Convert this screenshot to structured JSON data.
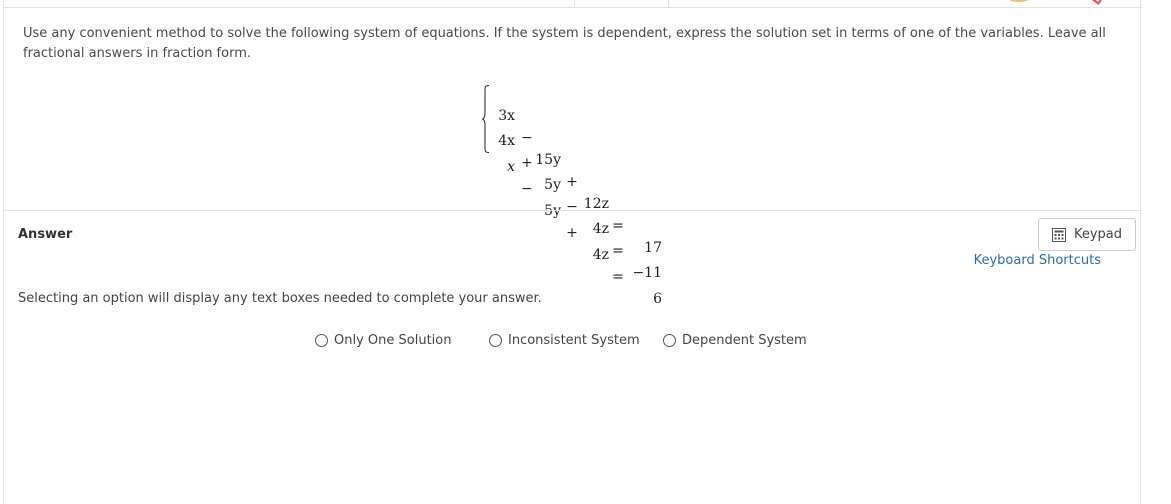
{
  "question": {
    "text": "Use any convenient method to solve the following system of equations. If the system is dependent, express the solution set in terms of one of the variables. Leave all fractional answers in fraction form."
  },
  "system": {
    "equations": [
      {
        "x": "3x",
        "op1": "−",
        "y": "15y",
        "op2": "+",
        "z": "12z",
        "rhs": "17"
      },
      {
        "x": "4x",
        "op1": "+",
        "y": "5y",
        "op2": "−",
        "z": "4z",
        "rhs": "−11"
      },
      {
        "x": "x",
        "op1": "−",
        "y": "5y",
        "op2": "+",
        "z": "4z",
        "rhs": "6"
      }
    ]
  },
  "answer": {
    "label": "Answer",
    "keypad_label": "Keypad",
    "keypad_icon": "calculator-icon",
    "shortcuts_label": "Keyboard Shortcuts",
    "instruction": "Selecting an option will display any text boxes needed to complete your answer.",
    "options": [
      {
        "label": "Only One Solution",
        "selected": false
      },
      {
        "label": "Inconsistent System",
        "selected": false
      },
      {
        "label": "Dependent System",
        "selected": false
      }
    ]
  },
  "colors": {
    "link": "#2d6ca2",
    "border": "#e2e2e2",
    "text": "#444444"
  }
}
